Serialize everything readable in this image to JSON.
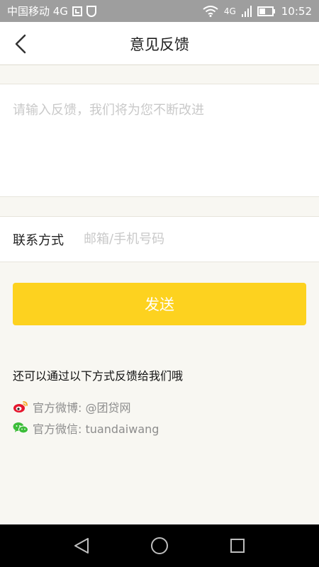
{
  "status_bar": {
    "carrier": "中国移动 4G",
    "network_small": "4G",
    "time": "10:52"
  },
  "header": {
    "title": "意见反馈"
  },
  "feedback": {
    "placeholder": "请输入反馈，我们将为您不断改进"
  },
  "contact": {
    "label": "联系方式",
    "placeholder": "邮箱/手机号码"
  },
  "send_label": "发送",
  "other_channels": {
    "title": "还可以通过以下方式反馈给我们哦",
    "weibo": "官方微博: @团贷网",
    "wechat": "官方微信: tuandaiwang"
  },
  "colors": {
    "accent": "#fdd21f",
    "background": "#f8f7f2",
    "status_bar": "#9e9e9e"
  },
  "icons": {
    "back": "back-arrow-icon",
    "weibo": "weibo-icon",
    "wechat": "wechat-icon"
  }
}
